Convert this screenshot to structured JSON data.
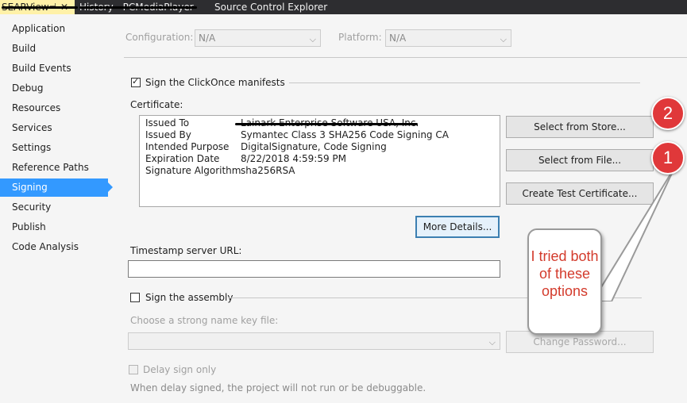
{
  "tabs": [
    {
      "label": "SEARView",
      "pin": "⊣",
      "close": "✕"
    },
    {
      "label": "History - PCMediaPlayer"
    },
    {
      "label": "Source Control Explorer"
    }
  ],
  "sidebar": {
    "items": [
      {
        "label": "Application"
      },
      {
        "label": "Build"
      },
      {
        "label": "Build Events"
      },
      {
        "label": "Debug"
      },
      {
        "label": "Resources"
      },
      {
        "label": "Services"
      },
      {
        "label": "Settings"
      },
      {
        "label": "Reference Paths"
      },
      {
        "label": "Signing",
        "active": true
      },
      {
        "label": "Security"
      },
      {
        "label": "Publish"
      },
      {
        "label": "Code Analysis"
      }
    ]
  },
  "config": {
    "configuration_label": "Configuration:",
    "configuration_value": "N/A",
    "platform_label": "Platform:",
    "platform_value": "N/A"
  },
  "signing": {
    "sign_manifests_label": "Sign the ClickOnce manifests",
    "sign_manifests_checked": true,
    "certificate_label": "Certificate:",
    "certificate": {
      "rows": [
        {
          "key": "Issued To",
          "value": "Lainark Enterprise Software USA, Inc."
        },
        {
          "key": "Issued By",
          "value": "Symantec Class 3 SHA256 Code Signing CA"
        },
        {
          "key": "Intended Purpose",
          "value": "DigitalSignature, Code Signing"
        },
        {
          "key": "Expiration Date",
          "value": "8/22/2018 4:59:59 PM"
        },
        {
          "key": "Signature Algorithm",
          "value": "sha256RSA"
        }
      ]
    },
    "select_from_store": "Select from Store...",
    "select_from_file": "Select from File...",
    "create_test_certificate": "Create Test Certificate...",
    "more_details": "More Details...",
    "timestamp_label": "Timestamp server URL:",
    "timestamp_value": "",
    "sign_assembly_label": "Sign the assembly",
    "sign_assembly_checked": false,
    "strong_name_label": "Choose a strong name key file:",
    "change_password": "Change Password...",
    "delay_sign_label": "Delay sign only",
    "delay_sign_note": "When delay signed, the project will not run or be debuggable."
  },
  "annotations": {
    "badge_1": "1",
    "badge_2": "2",
    "bubble_text": "I tried both of these options",
    "badge_color": "#e0383a",
    "bubble_text_color": "#d33b2c"
  },
  "colors": {
    "accent": "#3399ff",
    "tabbar": "#2d2d30",
    "active_tab": "#fff1a8"
  }
}
